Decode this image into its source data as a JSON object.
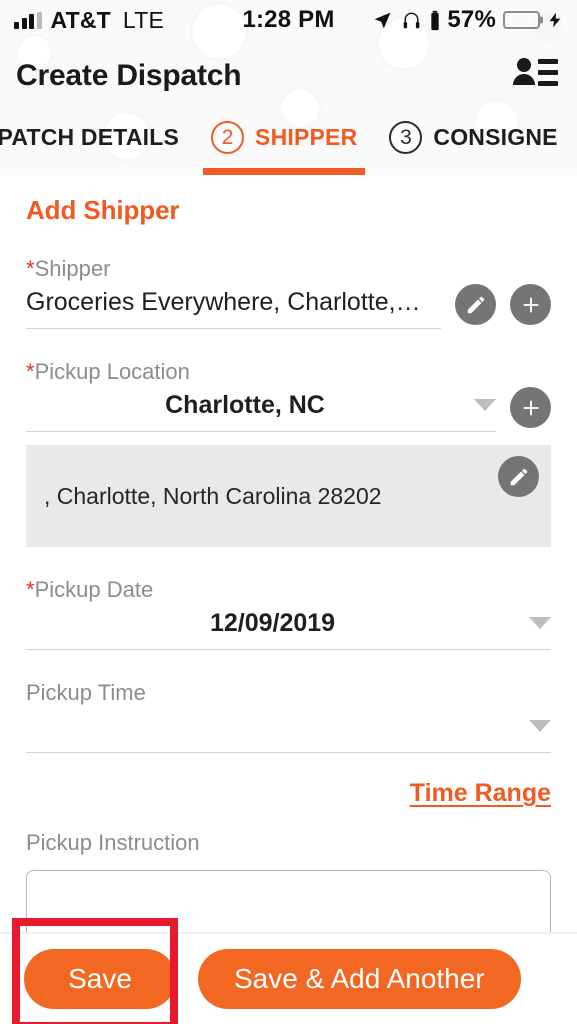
{
  "status_bar": {
    "carrier": "AT&T",
    "network": "LTE",
    "time": "1:28 PM",
    "battery_percent": "57%",
    "battery_level": 57,
    "battery_color": "#4cd864",
    "icons": [
      "signal-bars-icon",
      "location-arrow-icon",
      "headphones-icon",
      "battery-icon",
      "charging-bolt-icon"
    ]
  },
  "header": {
    "title": "Create Dispatch",
    "action_icon": "contacts-list-icon"
  },
  "tabs": {
    "items": [
      {
        "number": "",
        "label": "SPATCH DETAILS",
        "active": false
      },
      {
        "number": "2",
        "label": "SHIPPER",
        "active": true
      },
      {
        "number": "3",
        "label": "CONSIGNE",
        "active": false
      }
    ],
    "accent_color": "#f05a23"
  },
  "form": {
    "section_title": "Add Shipper",
    "shipper": {
      "label": "Shipper",
      "required_marker": "*",
      "value": "Groceries Everywhere, Charlotte,…",
      "edit_icon": "pencil-icon",
      "add_icon": "plus-icon"
    },
    "pickup_location": {
      "label": "Pickup Location",
      "required_marker": "*",
      "value": "Charlotte, NC",
      "add_icon": "plus-icon",
      "dropdown_icon": "caret-down-icon"
    },
    "address_card": {
      "text": ", Charlotte, North Carolina 28202",
      "edit_icon": "pencil-icon"
    },
    "pickup_date": {
      "label": "Pickup Date",
      "required_marker": "*",
      "value": "12/09/2019",
      "dropdown_icon": "caret-down-icon"
    },
    "pickup_time": {
      "label": "Pickup Time",
      "required_marker": "",
      "value": "",
      "dropdown_icon": "caret-down-icon"
    },
    "time_range_link": "Time Range",
    "pickup_instruction": {
      "label": "Pickup Instruction",
      "value": ""
    }
  },
  "bottom_bar": {
    "save_label": "Save",
    "save_add_another_label": "Save & Add Another",
    "button_color": "#f26722"
  },
  "annotation": {
    "color": "#e8192c",
    "target": "save-button"
  }
}
